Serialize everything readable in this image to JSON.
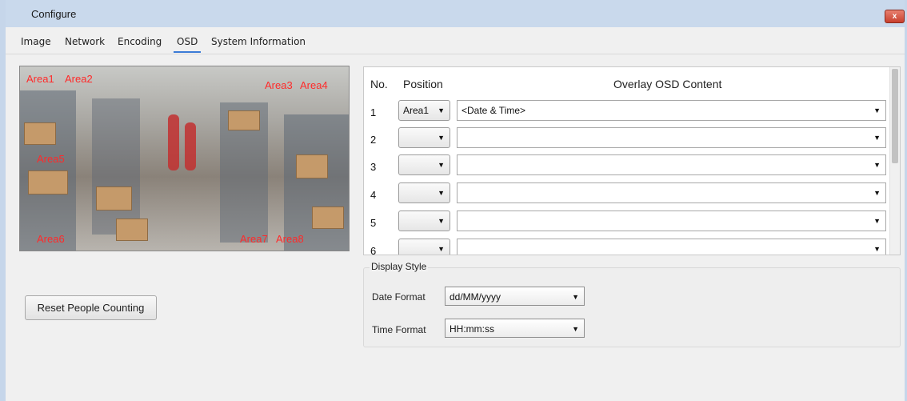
{
  "window": {
    "title": "Configure",
    "close_label": "x"
  },
  "tabs": [
    "Image",
    "Network",
    "Encoding",
    "OSD",
    "System Information"
  ],
  "active_tab": "OSD",
  "preview": {
    "areas": [
      "Area1",
      "Area2",
      "Area3",
      "Area4",
      "Area5",
      "Area6",
      "Area7",
      "Area8"
    ]
  },
  "reset_button": "Reset People Counting",
  "osd": {
    "headers": {
      "no": "No.",
      "position": "Position",
      "content": "Overlay OSD Content"
    },
    "rows": [
      {
        "no": "1",
        "position": "Area1",
        "content": "<Date & Time>"
      },
      {
        "no": "2",
        "position": "",
        "content": ""
      },
      {
        "no": "3",
        "position": "",
        "content": ""
      },
      {
        "no": "4",
        "position": "",
        "content": ""
      },
      {
        "no": "5",
        "position": "",
        "content": ""
      },
      {
        "no": "6",
        "position": "",
        "content": ""
      }
    ]
  },
  "display_style": {
    "legend": "Display Style",
    "date_label": "Date Format",
    "date_value": "dd/MM/yyyy",
    "time_label": "Time Format",
    "time_value": "HH:mm:ss"
  },
  "colors": {
    "area_label": "#ff2a2a",
    "active_tab_underline": "#3b7bd6",
    "close_button": "#d0503c"
  }
}
